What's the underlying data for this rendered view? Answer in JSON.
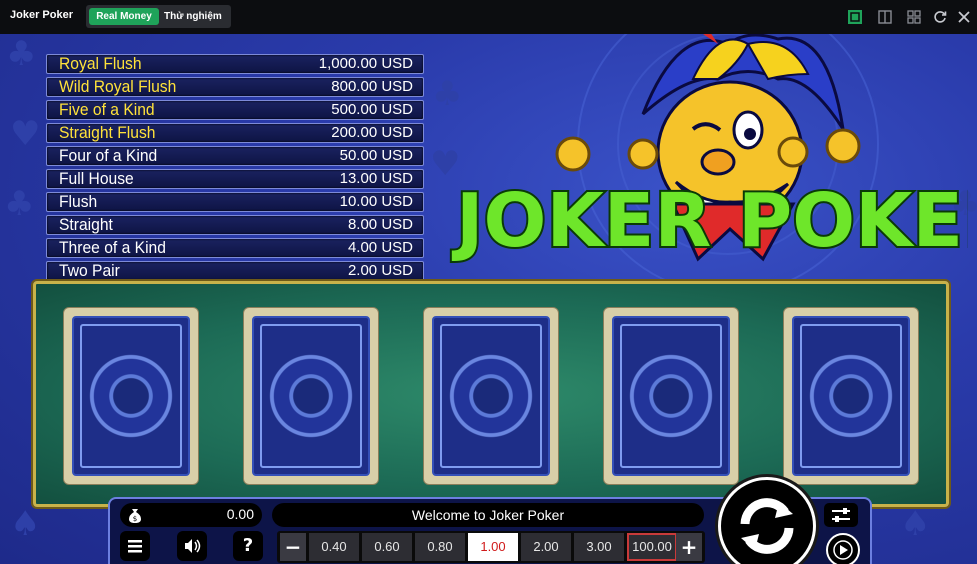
{
  "topbar": {
    "title": "Joker Poker",
    "mode_real": "Real Money",
    "mode_demo": "Thử nghiệm",
    "icons": [
      "fullscreen-icon",
      "split-view-icon",
      "grid-view-icon",
      "refresh-icon",
      "close-icon"
    ]
  },
  "paytable": [
    {
      "hand": "Royal Flush",
      "payout": "1,000.00 USD",
      "highlight": true
    },
    {
      "hand": "Wild Royal Flush",
      "payout": "800.00 USD",
      "highlight": true
    },
    {
      "hand": "Five of a Kind",
      "payout": "500.00 USD",
      "highlight": true
    },
    {
      "hand": "Straight Flush",
      "payout": "200.00 USD",
      "highlight": true
    },
    {
      "hand": "Four of a Kind",
      "payout": "50.00 USD",
      "highlight": false
    },
    {
      "hand": "Full House",
      "payout": "13.00 USD",
      "highlight": false
    },
    {
      "hand": "Flush",
      "payout": "10.00 USD",
      "highlight": false
    },
    {
      "hand": "Straight",
      "payout": "8.00 USD",
      "highlight": false
    },
    {
      "hand": "Three of a Kind",
      "payout": "4.00 USD",
      "highlight": false
    },
    {
      "hand": "Two Pair",
      "payout": "2.00 USD",
      "highlight": false
    }
  ],
  "logo": {
    "word1": "JOKER",
    "word2": "POKER"
  },
  "cards": [
    "card-back",
    "card-back",
    "card-back",
    "card-back",
    "card-back"
  ],
  "panel": {
    "balance": "0.00",
    "message": "Welcome to Joker Poker",
    "menu_icon": "menu-icon",
    "sound_icon": "sound-icon",
    "help_label": "?",
    "minus_label": "−",
    "plus_label": "+",
    "stakes": [
      "0.40",
      "0.60",
      "0.80",
      "1.00",
      "2.00",
      "3.00",
      "100.00"
    ],
    "selected_stake": "1.00",
    "max_stake": "100.00"
  },
  "colors": {
    "accent_green": "#1fa35a",
    "paytable_gold": "#ffe23a",
    "felt": "#1c6a55",
    "selected_stake_text": "#d01a1a"
  }
}
